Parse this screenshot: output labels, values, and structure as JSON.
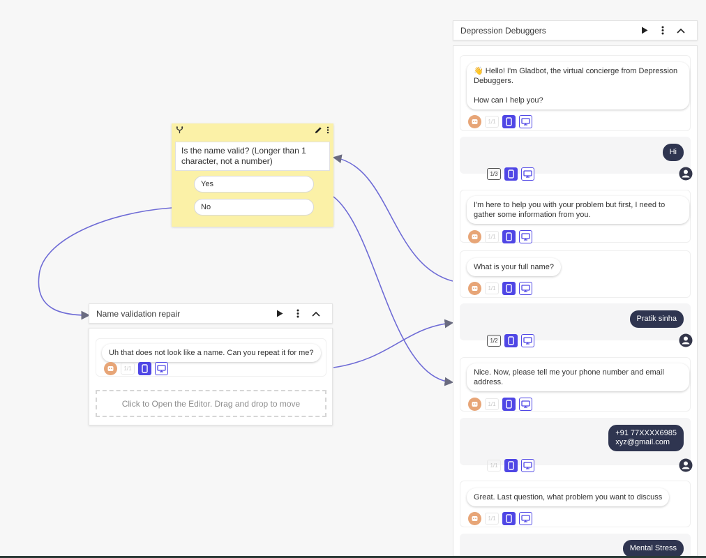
{
  "canvas": {
    "connector_color": "#6f6cd6",
    "accent_color": "#4f46e5",
    "node_yellow": "#fbf1a7",
    "user_bubble_color": "#2f3550"
  },
  "condition_node": {
    "icons": [
      "branch-icon",
      "pencil-icon",
      "more-vertical-icon"
    ],
    "question": "Is the name valid? (Longer than 1 character, not a number)",
    "options": [
      "Yes",
      "No"
    ]
  },
  "repair_node": {
    "title": "Name validation repair",
    "message": "Uh that does not look like a name. Can you repeat it for me?",
    "counter": "1/1",
    "editor_hint": "Click to Open the Editor. Drag and drop to move"
  },
  "chat_panel": {
    "title": "Depression Debuggers",
    "messages": [
      {
        "from": "bot",
        "text": "👋 Hello! I'm Gladbot, the virtual concierge from  Depression Debuggers.\n\nHow can I help you?",
        "counter": "1/1"
      },
      {
        "from": "user",
        "text": "Hi",
        "counter": "1/3"
      },
      {
        "from": "bot",
        "text": "I'm here to help you with your problem but first, I need to gather some information from you.",
        "counter": "1/1"
      },
      {
        "from": "bot",
        "text": "What is your full name?",
        "counter": "1/1"
      },
      {
        "from": "user",
        "text": "Pratik sinha",
        "counter": "1/2"
      },
      {
        "from": "bot",
        "text": "Nice. Now, please tell me your phone number and email address.",
        "counter": "1/1"
      },
      {
        "from": "user",
        "text": "+91 77XXXX6985\nxyz@gmail.com",
        "counter": "1/1"
      },
      {
        "from": "bot",
        "text": "Great. Last question, what problem you want to discuss",
        "counter": "1/1"
      },
      {
        "from": "user",
        "text": "Mental Stress",
        "counter": ""
      }
    ]
  }
}
